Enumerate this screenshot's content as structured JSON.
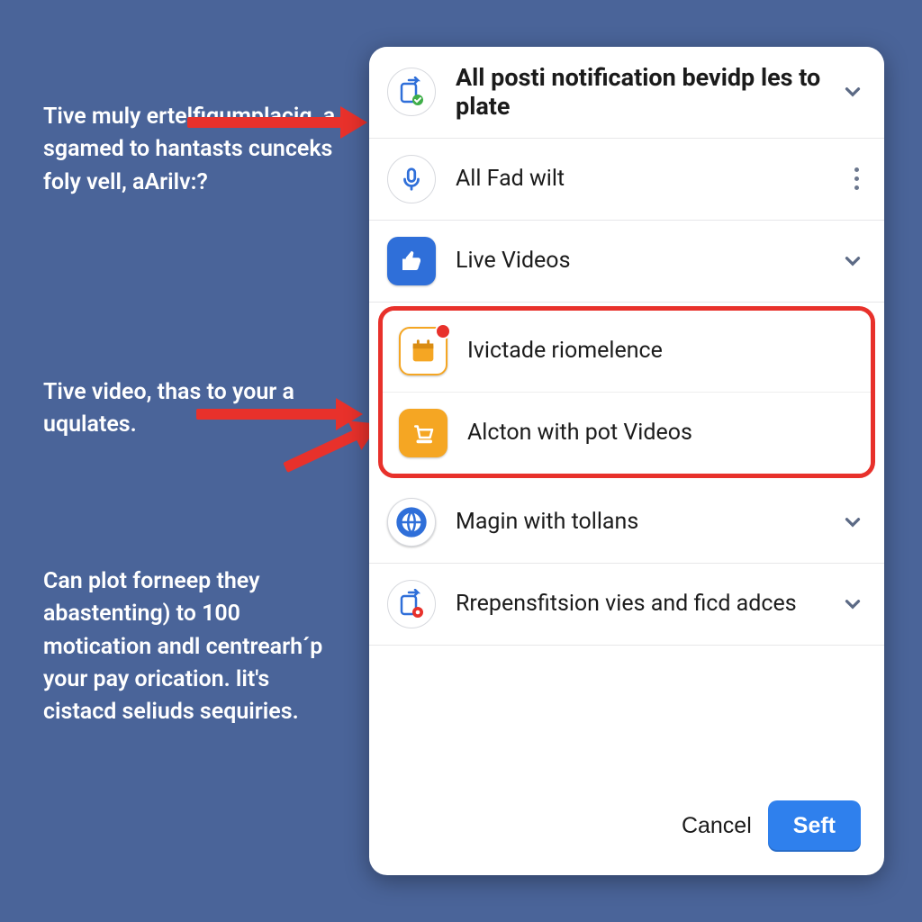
{
  "captions": {
    "c1": "Tive muly ertelfigumplacig, a sgamed to hantasts cunceks foly vell, aArilv:?",
    "c2": "Tive video, thas to your a uqulates.",
    "c3": "Can plot forneep they abastenting) to 100 motication andl centrearh´p your pay orication. lit's cistacd seliuds sequiries."
  },
  "panel": {
    "rows": [
      {
        "label": "All posti notification bevidp les to plate",
        "bold": true,
        "right": "chev"
      },
      {
        "label": "All Fad wilt",
        "right": "dots"
      },
      {
        "label": "Live Videos",
        "right": "chev"
      }
    ],
    "highlight": [
      {
        "label": "Ivictade riomelence"
      },
      {
        "label": "Alcton with pot Videos"
      }
    ],
    "rows2": [
      {
        "label": "Magin with tollans",
        "right": "chev"
      },
      {
        "label": "Rrepensfitsion vies and ficd adces",
        "right": "chev"
      }
    ],
    "footer": {
      "cancel": "Cancel",
      "primary": "Seft"
    }
  },
  "colors": {
    "accent_blue": "#2f6fd9",
    "accent_red": "#e8312b",
    "accent_orange": "#f5a623",
    "bg": "#4a6499"
  }
}
